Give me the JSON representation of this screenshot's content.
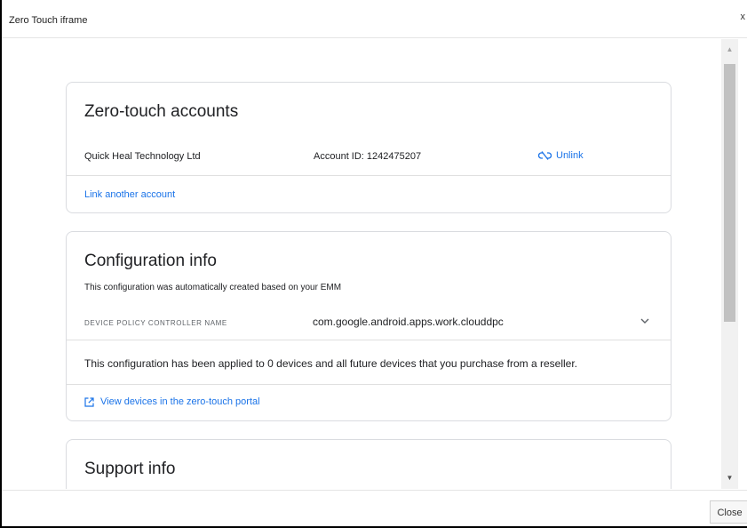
{
  "dialog": {
    "title": "Zero Touch iframe",
    "close_glyph": "x",
    "footer_close_label": "Close"
  },
  "accounts_card": {
    "title": "Zero-touch accounts",
    "company": "Quick Heal Technology Ltd",
    "account_id": "Account ID: 1242475207",
    "unlink_label": "Unlink",
    "unlink_icon": "link-off-icon",
    "link_another_label": "Link another account"
  },
  "config_card": {
    "title": "Configuration info",
    "subtitle": "This configuration was automatically created based on your EMM",
    "dpc_label": "DEVICE POLICY CONTROLLER NAME",
    "dpc_value": "com.google.android.apps.work.clouddpc",
    "applied_text": "This configuration has been applied to 0 devices and all future devices that you purchase from a reseller.",
    "view_devices_label": "View devices in the zero-touch portal",
    "view_devices_icon": "open-in-new-icon"
  },
  "support_card": {
    "title": "Support info"
  },
  "colors": {
    "link": "#1a73e8",
    "card_border": "#dadce0"
  }
}
